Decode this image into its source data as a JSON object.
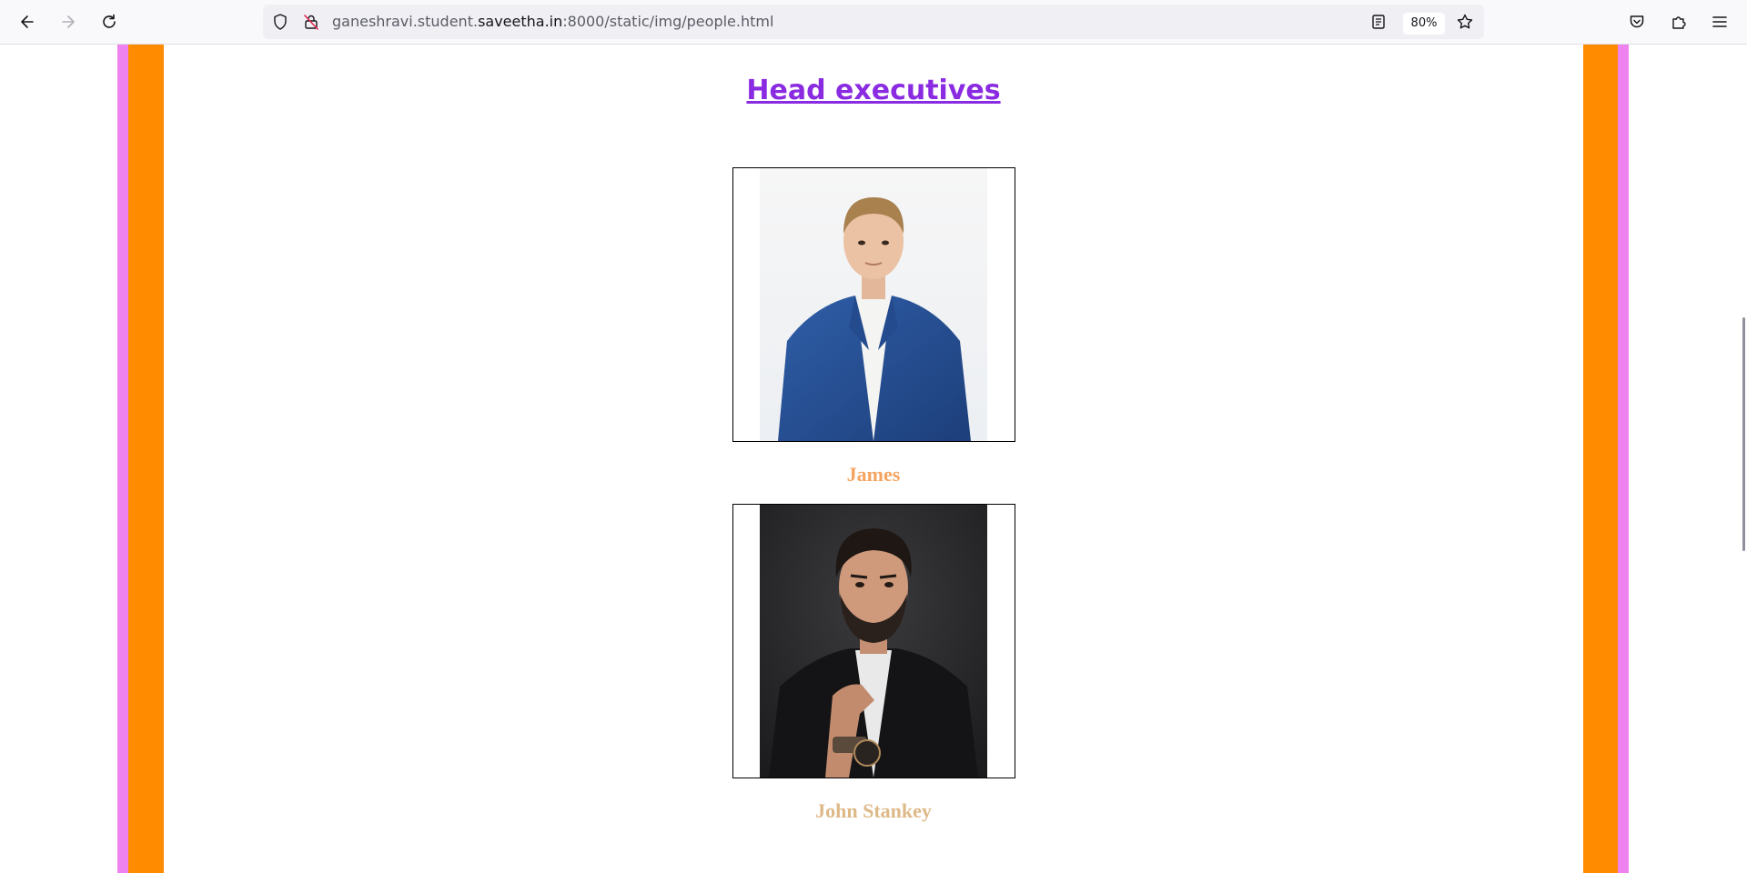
{
  "browser": {
    "url_prefix": "ganeshravi.student.",
    "url_domain": "saveetha.in",
    "url_suffix": ":8000/static/img/people.html",
    "zoom": "80%",
    "icons": {
      "back": "back-arrow-icon",
      "forward": "forward-arrow-icon",
      "reload": "reload-icon",
      "tracking": "shield-icon",
      "insecure": "insecure-lock-icon",
      "reader": "reader-view-icon",
      "bookmark": "star-icon",
      "pocket": "pocket-icon",
      "extensions": "puzzle-icon",
      "menu": "hamburger-menu-icon"
    }
  },
  "page": {
    "heading": "Head executives",
    "people": [
      {
        "name": "James",
        "photo": "man in blue suit photo"
      },
      {
        "name": "John Stankey",
        "photo": "bearded man in black suit photo"
      }
    ]
  },
  "colors": {
    "outer_stripe": "#ee82ee",
    "inner_stripe": "#ff8c00",
    "heading": "#8a2be2",
    "name_james": "#f4a460",
    "name_john": "#deb887"
  }
}
